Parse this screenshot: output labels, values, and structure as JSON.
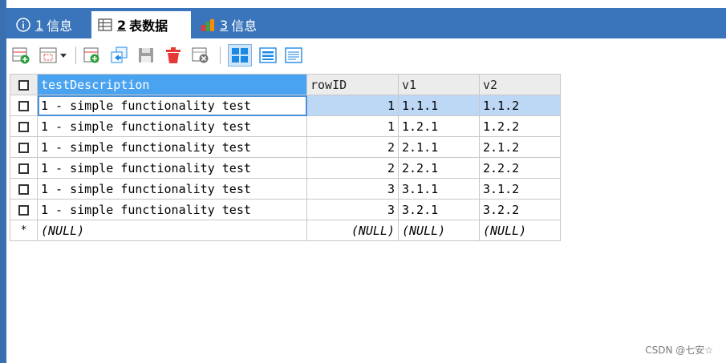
{
  "tabs": [
    {
      "num": "1",
      "label": "信息",
      "icon": "info-icon"
    },
    {
      "num": "2",
      "label": "表数据",
      "icon": "table-icon"
    },
    {
      "num": "3",
      "label": "信息",
      "icon": "chart-icon"
    }
  ],
  "toolbar": {
    "icons": [
      "add-record-icon",
      "view-mode-icon",
      "insert-icon",
      "duplicate-icon",
      "save-icon",
      "delete-icon",
      "discard-icon",
      "grid-view-icon",
      "form-view-icon",
      "text-view-icon"
    ]
  },
  "table": {
    "columns": [
      "testDescription",
      "rowID",
      "v1",
      "v2"
    ],
    "rows": [
      [
        "1 - simple functionality test",
        "1",
        "1.1.1",
        "1.1.2"
      ],
      [
        "1 - simple functionality test",
        "1",
        "1.2.1",
        "1.2.2"
      ],
      [
        "1 - simple functionality test",
        "2",
        "2.1.1",
        "2.1.2"
      ],
      [
        "1 - simple functionality test",
        "2",
        "2.2.1",
        "2.2.2"
      ],
      [
        "1 - simple functionality test",
        "3",
        "3.1.1",
        "3.1.2"
      ],
      [
        "1 - simple functionality test",
        "3",
        "3.2.1",
        "3.2.2"
      ]
    ],
    "new_row_marker": "*",
    "null_row": [
      "(NULL)",
      "(NULL)",
      "(NULL)",
      "(NULL)"
    ]
  },
  "watermark": "CSDN @七安☆",
  "colors": {
    "tab_bar": "#3a74ba",
    "selected_header": "#4aa3f0",
    "current_row": "#bcd8f5"
  }
}
